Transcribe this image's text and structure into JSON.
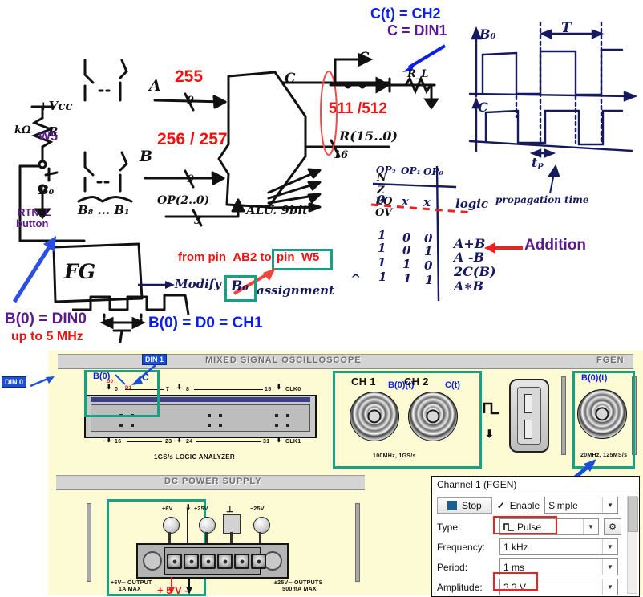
{
  "annotations": {
    "c_ch2": "C(t) = CH2",
    "c_din1": "C = DIN1",
    "val_255": "255",
    "val_256_257": "256 / 257",
    "val_511_512": "511 /512",
    "w5": "W5",
    "rtn_l": "RTN_L",
    "rtn_l2": "button",
    "from_pin": "from pin_AB2 to ",
    "pin_w5": "pin_W5",
    "addition": "Addition",
    "b0_din0": "B(0) = DIN0",
    "up_to_5mhz": "up to 5 MHz",
    "b0_d0_ch1": "B(0) = D0 = CH1",
    "caret": "^"
  },
  "sketch": {
    "vcc": "+Vcc",
    "r": "R",
    "kohm": "kΩ",
    "b0": "B₀",
    "fg": "FG",
    "a": "A",
    "b": "B",
    "c": "C",
    "nine": "9",
    "three": "3",
    "sixteen": "16",
    "op_label": "OP(2..0)",
    "alu_label": "ALU. 9bit",
    "r_bus": "R(15..0)",
    "rl": "R_L",
    "flag_n": "N",
    "flag_z": "Z",
    "flag_eq": "EQ",
    "flag_ov": "OV",
    "bn_b1": "B₈ ... B₁",
    "modify": "Modify",
    "assignment": "assignment",
    "b0_box": "B₀",
    "period_T": "T",
    "period_T_wave": "T",
    "tp": "tₚ",
    "wave_b0": "B₀",
    "wave_c": "C",
    "prop_time": "propagation time"
  },
  "truth_table": {
    "headers": [
      "OP₂",
      "OP₁",
      "OP₀"
    ],
    "result_header": "logic",
    "rows": [
      {
        "op2": "0",
        "op1": "x",
        "op0": "x",
        "result": "logic"
      },
      {
        "op2": "1",
        "op1": "0",
        "op0": "0",
        "result": "A+B"
      },
      {
        "op2": "1",
        "op1": "0",
        "op0": "1",
        "result": "A -B"
      },
      {
        "op2": "1",
        "op1": "1",
        "op0": "0",
        "result": "2C(B)"
      },
      {
        "op2": "1",
        "op1": "1",
        "op0": "1",
        "result": "A∗B"
      }
    ]
  },
  "instrument": {
    "scope_header": "MIXED SIGNAL OSCILLOSCOPE",
    "fgen_header": "FGEN",
    "psu_header": "DC POWER SUPPLY",
    "logic_analyzer_caption": "1GS/s LOGIC ANALYZER",
    "la_labels": {
      "din0_badge": "DIN 0",
      "din1_badge": "DIN 1",
      "b0": "B(0)",
      "c": "C",
      "d0": "D0",
      "d1": "D1",
      "pin0": "0",
      "pin7": "7",
      "pin8": "8",
      "pin15": "15",
      "clk0": "CLK0",
      "pin16": "16",
      "pin23": "23",
      "pin24": "24",
      "pin31": "31",
      "clk1": "CLK1"
    },
    "ch1": {
      "name": "CH 1",
      "annot": "B(0)(t)"
    },
    "ch2": {
      "name": "CH 2",
      "annot": "C(t)"
    },
    "scope_spec": "100MHz, 1GS/s",
    "fgen_annot": "B(0)(t)",
    "fgen_spec": "20MHz, 125MS/s",
    "psu": {
      "t_plus6": "+6V",
      "t_plus25": "+25V",
      "t_gnd": "⊥",
      "t_minus25": "−25V",
      "left_note1": "+6V═ OUTPUT",
      "left_note2": "1A MAX",
      "right_note1": "±25V═ OUTPUTS",
      "right_note2": "500mA MAX",
      "red_note": "+ 5 V -"
    }
  },
  "fgen_dialog": {
    "title": "Channel 1 (FGEN)",
    "stop_label": "Stop",
    "enable_check": "✓",
    "enable_label": "Enable",
    "mode_value": "Simple",
    "fields": [
      {
        "label": "Type:",
        "value": "Pulse",
        "highlight": true,
        "icon": "pulse-icon"
      },
      {
        "label": "Frequency:",
        "value": "1 kHz",
        "highlight": false
      },
      {
        "label": "Period:",
        "value": "1 ms",
        "highlight": false
      },
      {
        "label": "Amplitude:",
        "value": "3.3 V",
        "highlight": true
      }
    ]
  },
  "colors": {
    "blue": "#0b1fe8",
    "purple": "#5b1a8c",
    "red": "#ef1111",
    "teal": "#17a184",
    "panel_bg": "#fdfbd4",
    "bar_bg": "#d4d4d4"
  }
}
